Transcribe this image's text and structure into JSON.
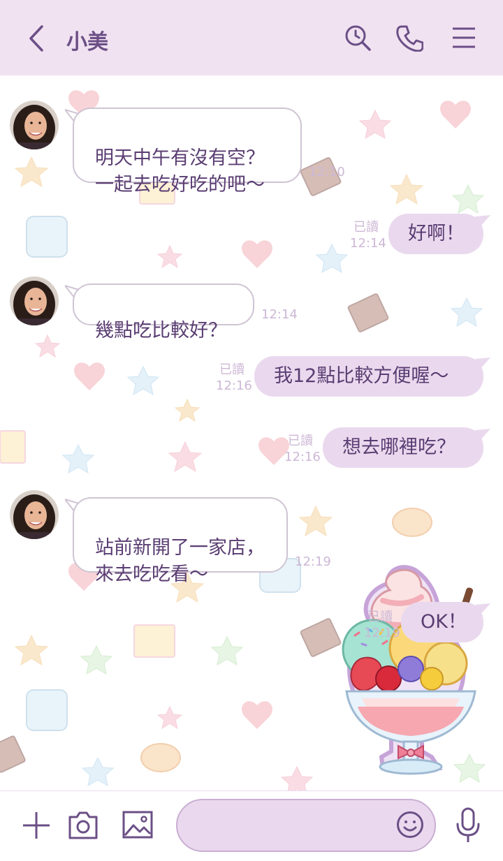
{
  "header": {
    "back_icon": "chevron-left-icon",
    "contact_name": "小美",
    "icons": [
      "search-history-icon",
      "phone-icon",
      "menu-icon"
    ]
  },
  "colors": {
    "header_bg": "#f1e2f1",
    "accent": "#6b4f86",
    "outgoing_bubble": "#ead9ee",
    "incoming_border": "#cfc4d3",
    "text": "#5a3d72",
    "meta": "#cdb8d6"
  },
  "messages": [
    {
      "side": "in",
      "text": "明天中午有沒有空？\n一起去吃好吃的吧～",
      "time": "12:10"
    },
    {
      "side": "out",
      "text": "好啊！",
      "read": "已讀",
      "time": "12:14"
    },
    {
      "side": "in",
      "text": "幾點吃比較好？",
      "time": "12:14"
    },
    {
      "side": "out",
      "text": "我12點比較方便喔～",
      "read": "已讀",
      "time": "12:16"
    },
    {
      "side": "out",
      "text": "想去哪裡吃？",
      "read": "已讀",
      "time": "12:16"
    },
    {
      "side": "in",
      "text": "站前新開了一家店，\n來去吃吃看～",
      "time": "12:19"
    },
    {
      "side": "out",
      "text": "OK！",
      "read": "已讀",
      "time": "12:19"
    }
  ],
  "sticker": "ice-cream-parfait-sticker",
  "footer": {
    "icons": [
      "plus-icon",
      "camera-icon",
      "image-icon",
      "emoji-icon",
      "microphone-icon"
    ],
    "input_placeholder": ""
  }
}
